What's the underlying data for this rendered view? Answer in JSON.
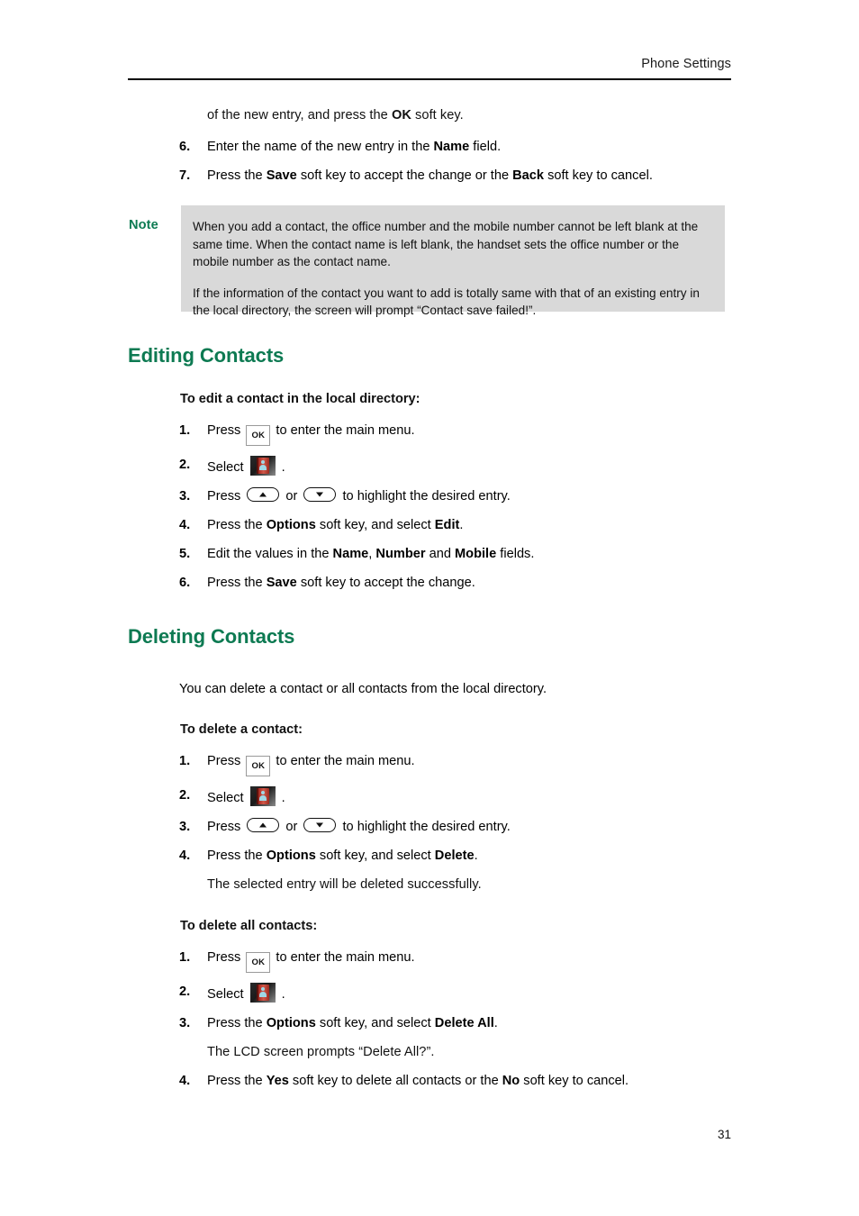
{
  "header": {
    "title": "Phone Settings"
  },
  "continuation": {
    "text_before_bold": "of the new entry, and press the ",
    "bold": "OK",
    "text_after_bold": " soft key."
  },
  "top_steps": [
    {
      "num": "6.",
      "pre": "Enter the name of the new entry in the ",
      "bold": "Name",
      "post": " field."
    },
    {
      "num": "7.",
      "pre": "Press the ",
      "bold": "Save",
      "mid": " soft key to accept the change or the ",
      "bold2": "Back",
      "post": " soft key to cancel."
    }
  ],
  "note": {
    "label": "Note",
    "paragraph1": "When you add a contact, the office number and the mobile number cannot be left blank at the same time. When the contact name is left blank, the handset sets the office number or the mobile number as the contact name.",
    "paragraph2": "If the information of the contact you want to add is totally same with that of an existing entry in the local directory, the screen will prompt “Contact save failed!”."
  },
  "editing_section": {
    "heading": "Editing Contacts",
    "subheading": "To edit a contact in the local directory:",
    "steps": [
      {
        "num": "1.",
        "pre": "Press ",
        "icon": "ok-key-icon",
        "icon_label": "OK",
        "post": " to enter the main menu."
      },
      {
        "num": "2.",
        "pre": "Select ",
        "icon": "directory-icon",
        "post": " ."
      },
      {
        "num": "3.",
        "pre": "Press ",
        "icon": "arrow-up-key-icon",
        "mid": " or ",
        "icon2": "arrow-down-key-icon",
        "post": " to highlight the desired entry."
      },
      {
        "num": "4.",
        "pre": "Press the ",
        "bold": "Options",
        "mid": " soft key, and select ",
        "bold2": "Edit",
        "post": "."
      },
      {
        "num": "5.",
        "pre": "Edit the values in the ",
        "bold": "Name",
        "mid": ", ",
        "bold2": "Number",
        "mid2": " and ",
        "bold3": "Mobile",
        "post": " fields."
      },
      {
        "num": "6.",
        "pre": "Press the ",
        "bold": "Save",
        "post": " soft key to accept the change."
      }
    ]
  },
  "deleting_section": {
    "heading": "Deleting Contacts",
    "intro": "You can delete a contact or all contacts from the local directory.",
    "subheading_one": "To delete a contact:",
    "steps_one": [
      {
        "num": "1.",
        "pre": "Press ",
        "icon": "ok-key-icon",
        "icon_label": "OK",
        "post": " to enter the main menu."
      },
      {
        "num": "2.",
        "pre": "Select ",
        "icon": "directory-icon",
        "post": " ."
      },
      {
        "num": "3.",
        "pre": "Press ",
        "icon": "arrow-up-key-icon",
        "mid": " or ",
        "icon2": "arrow-down-key-icon",
        "post": " to highlight the desired entry."
      },
      {
        "num": "4.",
        "pre": "Press the ",
        "bold": "Options",
        "mid": " soft key, and select ",
        "bold2": "Delete",
        "post": "."
      }
    ],
    "result_one": "The selected entry will be deleted successfully.",
    "subheading_all": "To delete all contacts:",
    "steps_all": [
      {
        "num": "1.",
        "pre": "Press ",
        "icon": "ok-key-icon",
        "icon_label": "OK",
        "post": " to enter the main menu."
      },
      {
        "num": "2.",
        "pre": "Select ",
        "icon": "directory-icon",
        "post": " ."
      },
      {
        "num": "3.",
        "pre": "Press the ",
        "bold": "Options",
        "mid": " soft key, and select ",
        "bold2": "Delete All",
        "post": "."
      }
    ],
    "result_all": "The LCD screen prompts “Delete All?”.",
    "final_step": {
      "num": "4.",
      "pre": "Press the ",
      "bold": "Yes",
      "mid": " soft key to delete all contacts or the ",
      "bold2": "No",
      "post": " soft key to cancel."
    }
  },
  "footer": {
    "page_number": "31"
  },
  "colors": {
    "heading_green": "#0d7a52",
    "note_background": "#d9d9d9",
    "text": "#111111"
  }
}
